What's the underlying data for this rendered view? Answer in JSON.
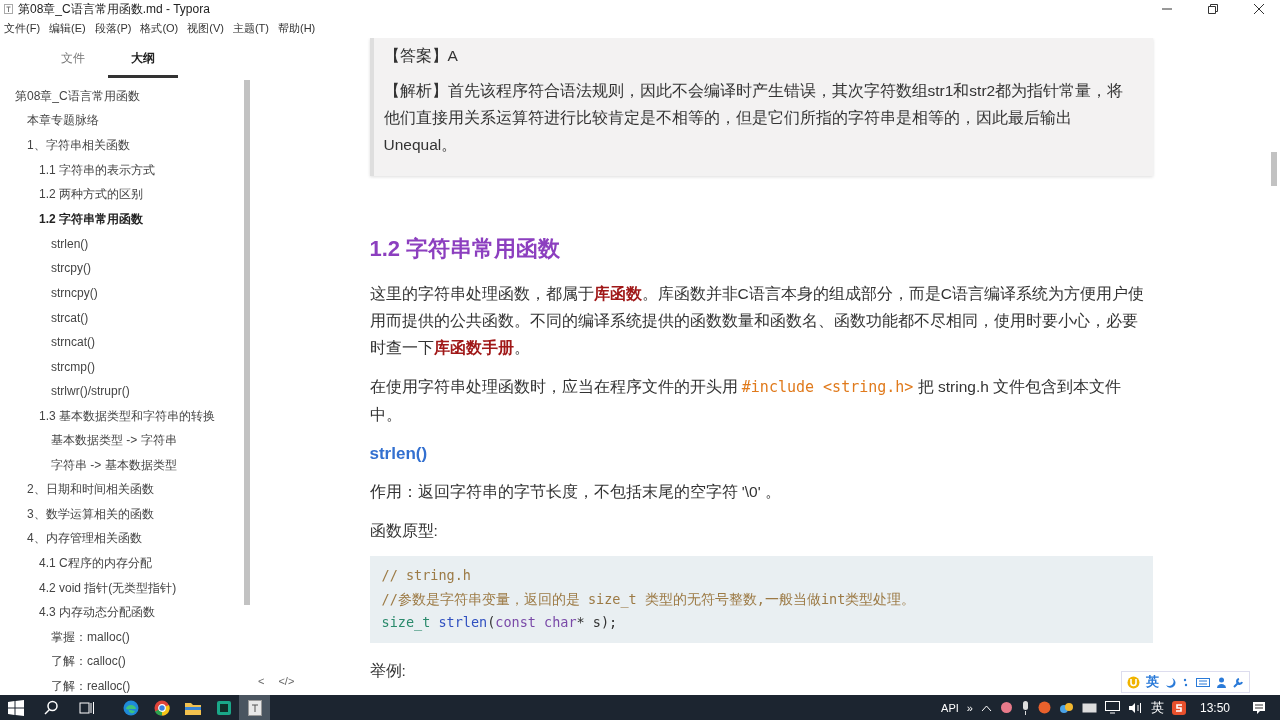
{
  "window": {
    "title": "第08章_C语言常用函数.md - Typora"
  },
  "menu": [
    "文件(F)",
    "编辑(E)",
    "段落(P)",
    "格式(O)",
    "视图(V)",
    "主题(T)",
    "帮助(H)"
  ],
  "sidebar": {
    "tabs": [
      {
        "label": "文件",
        "selected": false
      },
      {
        "label": "大纲",
        "selected": true
      }
    ],
    "outline": [
      {
        "label": "第08章_C语言常用函数",
        "selected": false,
        "children": [
          {
            "label": "本章专题脉络",
            "selected": false
          },
          {
            "label": "1、字符串相关函数",
            "selected": false,
            "children": [
              {
                "label": "1.1 字符串的表示方式",
                "selected": false
              },
              {
                "label": "1.2 两种方式的区别",
                "selected": false
              },
              {
                "label": "1.2 字符串常用函数",
                "selected": true,
                "children": [
                  {
                    "label": "strlen()",
                    "selected": false
                  },
                  {
                    "label": "strcpy()",
                    "selected": false
                  },
                  {
                    "label": "strncpy()",
                    "selected": false
                  },
                  {
                    "label": "strcat()",
                    "selected": false
                  },
                  {
                    "label": "strncat()",
                    "selected": false
                  },
                  {
                    "label": "strcmp()",
                    "selected": false
                  },
                  {
                    "label": "strlwr()/strupr()",
                    "selected": false
                  }
                ]
              },
              {
                "label": "1.3 基本数据类型和字符串的转换",
                "selected": false,
                "children": [
                  {
                    "label": "基本数据类型 -> 字符串",
                    "selected": false
                  },
                  {
                    "label": "字符串 -> 基本数据类型",
                    "selected": false
                  }
                ]
              }
            ]
          },
          {
            "label": "2、日期和时间相关函数",
            "selected": false
          },
          {
            "label": "3、数学运算相关的函数",
            "selected": false
          },
          {
            "label": "4、内存管理相关函数",
            "selected": false,
            "children": [
              {
                "label": "4.1 C程序的内存分配",
                "selected": false
              },
              {
                "label": "4.2 void 指针(无类型指针)",
                "selected": false
              },
              {
                "label": "4.3 内存动态分配函数",
                "selected": false,
                "children": [
                  {
                    "label": "掌握：malloc()",
                    "selected": false
                  },
                  {
                    "label": "了解：calloc()",
                    "selected": false
                  },
                  {
                    "label": "了解：realloc()",
                    "selected": false
                  }
                ]
              }
            ]
          }
        ]
      }
    ],
    "footer": [
      "<",
      "</>"
    ]
  },
  "document": {
    "blockquote": [
      "【答案】A",
      "【解析】首先该程序符合语法规则，因此不会编译时产生错误，其次字符数组str1和str2都为指针常量，将他们直接用关系运算符进行比较肯定是不相等的，但是它们所指的字符串是相等的，因此最后输出Unequal。"
    ],
    "heading": "1.2 字符串常用函数",
    "paragraphs": [
      [
        {
          "kind": "text",
          "text": "这里的字符串处理函数，都属于"
        },
        {
          "kind": "strong",
          "text": "库函数"
        },
        {
          "kind": "text",
          "text": "。库函数并非C语言本身的组成部分，而是C语言编译系统为方便用户使用而提供的公共函数。不同的编译系统提供的函数数量和函数名、函数功能都不尽相同，使用时要小心，必要时查一下"
        },
        {
          "kind": "strong",
          "text": "库函数手册"
        },
        {
          "kind": "text",
          "text": "。"
        }
      ],
      [
        {
          "kind": "text",
          "text": "在使用字符串处理函数时，应当在程序文件的开头用 "
        },
        {
          "kind": "code",
          "text": "#include <string.h>"
        },
        {
          "kind": "text",
          "text": " 把 string.h 文件包含到本文件中。"
        }
      ]
    ],
    "subheading": "strlen()",
    "paragraphs2": [
      "作用：返回字符串的字节长度，不包括末尾的空字符 '\\0' 。",
      "函数原型:"
    ],
    "code": [
      [
        {
          "kind": "comment",
          "text": "// string.h"
        }
      ],
      [
        {
          "kind": "comment",
          "text": "//参数是字符串变量，返回的是 size_t 类型的无符号整数,一般当做int类型处理。"
        }
      ],
      [
        {
          "kind": "type",
          "text": "size_t"
        },
        {
          "kind": "func",
          "text": " strlen"
        },
        {
          "kind": "plain",
          "text": "("
        },
        {
          "kind": "keyword",
          "text": "const"
        },
        {
          "kind": "keyword",
          "text": " char"
        },
        {
          "kind": "plain",
          "text": "* s);"
        }
      ]
    ],
    "after": "举例:"
  },
  "ime_bar": {
    "label": "英"
  },
  "taskbar": {
    "apps": [
      {
        "kind": "edge",
        "active": false
      },
      {
        "kind": "chrome",
        "active": false
      },
      {
        "kind": "folder",
        "active": false
      },
      {
        "kind": "terminal",
        "active": false
      },
      {
        "kind": "typora",
        "active": true
      }
    ],
    "tray": {
      "api": "API",
      "more": "»",
      "ime": "英",
      "time": "13:50"
    }
  }
}
